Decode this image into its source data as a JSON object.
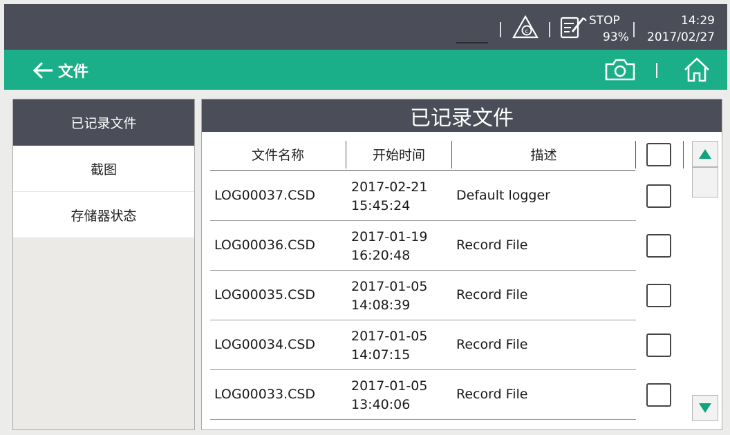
{
  "status": {
    "run_state": "STOP",
    "battery": "93%",
    "time": "14:29",
    "date": "2017/02/27"
  },
  "titlebar": {
    "title": "文件",
    "back_icon": "arrow-left-icon",
    "camera_icon": "camera-icon",
    "home_icon": "home-icon",
    "accent": "#1aaf88"
  },
  "sidebar": {
    "items": [
      {
        "label": "已记录文件",
        "active": true
      },
      {
        "label": "截图",
        "active": false
      },
      {
        "label": "存储器状态",
        "active": false
      }
    ]
  },
  "panel": {
    "title": "已记录文件",
    "columns": [
      "文件名称",
      "开始时间",
      "描述"
    ],
    "rows": [
      {
        "name": "LOG00037.CSD",
        "date": "2017-02-21",
        "time": "15:45:24",
        "desc": "Default logger"
      },
      {
        "name": "LOG00036.CSD",
        "date": "2017-01-19",
        "time": "16:20:48",
        "desc": "Record File"
      },
      {
        "name": "LOG00035.CSD",
        "date": "2017-01-05",
        "time": "14:08:39",
        "desc": "Record File"
      },
      {
        "name": "LOG00034.CSD",
        "date": "2017-01-05",
        "time": "14:07:15",
        "desc": "Record File"
      },
      {
        "name": "LOG00033.CSD",
        "date": "2017-01-05",
        "time": "13:40:06",
        "desc": "Record File"
      }
    ]
  },
  "colors": {
    "header_dark": "#4b4e59",
    "accent_green": "#1aaf88",
    "scroll_arrow": "#11a57e"
  }
}
